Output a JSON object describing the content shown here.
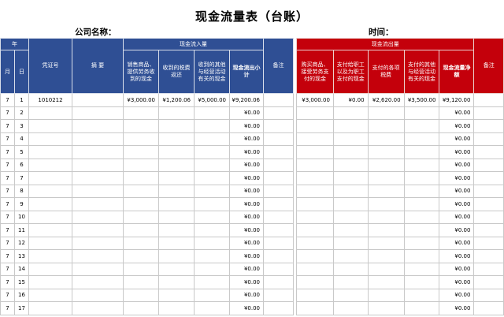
{
  "title": "现金流量表（台账）",
  "company_label": "公司名称：",
  "time_label": "时间：",
  "colors": {
    "blue_header": "#2f4f94",
    "red_header": "#c4000b",
    "grid": "#c9c9c9"
  },
  "left_header": {
    "year": "年",
    "month": "月",
    "day": "日",
    "voucher": "凭证号",
    "summary": "摘 要",
    "inflow_group": "现金流入量",
    "col_sales": "销售商品、提供劳务收到的现金",
    "col_tax": "收到的税费返还",
    "col_other_in": "收到的其他与经营活动有关的现金",
    "col_subtotal": "现金流出小计",
    "remark": "备注"
  },
  "right_header": {
    "outflow_group": "现金流出量",
    "col_purchase": "购买商品、接受劳务支付的现金",
    "col_staff": "支付给职工以及为职工支付的现金",
    "col_taxes": "支付的各项税费",
    "col_other_out": "支付的其他与经营活动有关的现金",
    "col_net": "现金流量净额",
    "remark": "备注"
  },
  "rows": [
    {
      "m": "7",
      "d": "1",
      "voucher": "1010212",
      "summary": "",
      "sales": "¥3,000.00",
      "tax": "¥1,200.06",
      "other_in": "¥5,000.00",
      "subtotal": "¥9,200.06",
      "remark": "",
      "purchase": "¥3,000.00",
      "staff": "¥0.00",
      "taxes": "¥2,620.00",
      "other_out": "¥3,500.00",
      "net": "¥9,120.00",
      "remark2": ""
    },
    {
      "m": "7",
      "d": "2",
      "voucher": "",
      "summary": "",
      "sales": "",
      "tax": "",
      "other_in": "",
      "subtotal": "¥0.00",
      "remark": "",
      "purchase": "",
      "staff": "",
      "taxes": "",
      "other_out": "",
      "net": "¥0.00",
      "remark2": ""
    },
    {
      "m": "7",
      "d": "3",
      "voucher": "",
      "summary": "",
      "sales": "",
      "tax": "",
      "other_in": "",
      "subtotal": "¥0.00",
      "remark": "",
      "purchase": "",
      "staff": "",
      "taxes": "",
      "other_out": "",
      "net": "¥0.00",
      "remark2": ""
    },
    {
      "m": "7",
      "d": "4",
      "voucher": "",
      "summary": "",
      "sales": "",
      "tax": "",
      "other_in": "",
      "subtotal": "¥0.00",
      "remark": "",
      "purchase": "",
      "staff": "",
      "taxes": "",
      "other_out": "",
      "net": "¥0.00",
      "remark2": ""
    },
    {
      "m": "7",
      "d": "5",
      "voucher": "",
      "summary": "",
      "sales": "",
      "tax": "",
      "other_in": "",
      "subtotal": "¥0.00",
      "remark": "",
      "purchase": "",
      "staff": "",
      "taxes": "",
      "other_out": "",
      "net": "¥0.00",
      "remark2": ""
    },
    {
      "m": "7",
      "d": "6",
      "voucher": "",
      "summary": "",
      "sales": "",
      "tax": "",
      "other_in": "",
      "subtotal": "¥0.00",
      "remark": "",
      "purchase": "",
      "staff": "",
      "taxes": "",
      "other_out": "",
      "net": "¥0.00",
      "remark2": ""
    },
    {
      "m": "7",
      "d": "7",
      "voucher": "",
      "summary": "",
      "sales": "",
      "tax": "",
      "other_in": "",
      "subtotal": "¥0.00",
      "remark": "",
      "purchase": "",
      "staff": "",
      "taxes": "",
      "other_out": "",
      "net": "¥0.00",
      "remark2": ""
    },
    {
      "m": "7",
      "d": "8",
      "voucher": "",
      "summary": "",
      "sales": "",
      "tax": "",
      "other_in": "",
      "subtotal": "¥0.00",
      "remark": "",
      "purchase": "",
      "staff": "",
      "taxes": "",
      "other_out": "",
      "net": "¥0.00",
      "remark2": ""
    },
    {
      "m": "7",
      "d": "9",
      "voucher": "",
      "summary": "",
      "sales": "",
      "tax": "",
      "other_in": "",
      "subtotal": "¥0.00",
      "remark": "",
      "purchase": "",
      "staff": "",
      "taxes": "",
      "other_out": "",
      "net": "¥0.00",
      "remark2": ""
    },
    {
      "m": "7",
      "d": "10",
      "voucher": "",
      "summary": "",
      "sales": "",
      "tax": "",
      "other_in": "",
      "subtotal": "¥0.00",
      "remark": "",
      "purchase": "",
      "staff": "",
      "taxes": "",
      "other_out": "",
      "net": "¥0.00",
      "remark2": ""
    },
    {
      "m": "7",
      "d": "11",
      "voucher": "",
      "summary": "",
      "sales": "",
      "tax": "",
      "other_in": "",
      "subtotal": "¥0.00",
      "remark": "",
      "purchase": "",
      "staff": "",
      "taxes": "",
      "other_out": "",
      "net": "¥0.00",
      "remark2": ""
    },
    {
      "m": "7",
      "d": "12",
      "voucher": "",
      "summary": "",
      "sales": "",
      "tax": "",
      "other_in": "",
      "subtotal": "¥0.00",
      "remark": "",
      "purchase": "",
      "staff": "",
      "taxes": "",
      "other_out": "",
      "net": "¥0.00",
      "remark2": ""
    },
    {
      "m": "7",
      "d": "13",
      "voucher": "",
      "summary": "",
      "sales": "",
      "tax": "",
      "other_in": "",
      "subtotal": "¥0.00",
      "remark": "",
      "purchase": "",
      "staff": "",
      "taxes": "",
      "other_out": "",
      "net": "¥0.00",
      "remark2": ""
    },
    {
      "m": "7",
      "d": "14",
      "voucher": "",
      "summary": "",
      "sales": "",
      "tax": "",
      "other_in": "",
      "subtotal": "¥0.00",
      "remark": "",
      "purchase": "",
      "staff": "",
      "taxes": "",
      "other_out": "",
      "net": "¥0.00",
      "remark2": ""
    },
    {
      "m": "7",
      "d": "15",
      "voucher": "",
      "summary": "",
      "sales": "",
      "tax": "",
      "other_in": "",
      "subtotal": "¥0.00",
      "remark": "",
      "purchase": "",
      "staff": "",
      "taxes": "",
      "other_out": "",
      "net": "¥0.00",
      "remark2": ""
    },
    {
      "m": "7",
      "d": "16",
      "voucher": "",
      "summary": "",
      "sales": "",
      "tax": "",
      "other_in": "",
      "subtotal": "¥0.00",
      "remark": "",
      "purchase": "",
      "staff": "",
      "taxes": "",
      "other_out": "",
      "net": "¥0.00",
      "remark2": ""
    },
    {
      "m": "7",
      "d": "17",
      "voucher": "",
      "summary": "",
      "sales": "",
      "tax": "",
      "other_in": "",
      "subtotal": "¥0.00",
      "remark": "",
      "purchase": "",
      "staff": "",
      "taxes": "",
      "other_out": "",
      "net": "¥0.00",
      "remark2": ""
    }
  ]
}
